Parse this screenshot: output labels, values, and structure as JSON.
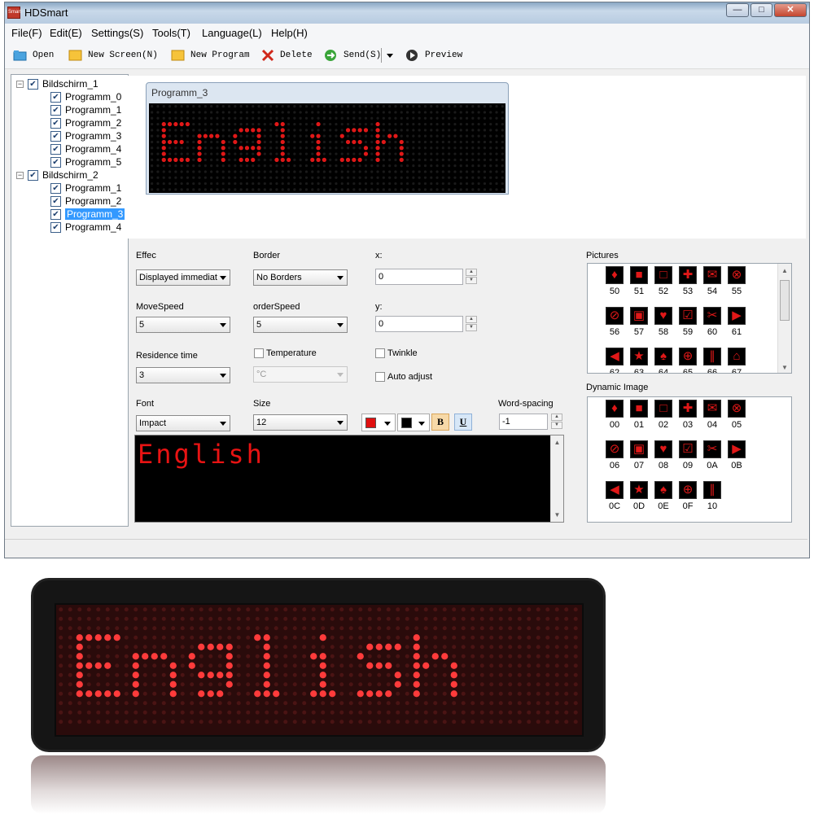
{
  "app": {
    "title": "HDSmart",
    "icon_label": "Smart"
  },
  "window_buttons": {
    "minimize": "—",
    "maximize": "□",
    "close": "✕"
  },
  "menu": [
    {
      "label": "File(F)"
    },
    {
      "label": "Edit(E)"
    },
    {
      "label": "Settings(S)"
    },
    {
      "label": "Tools(T)"
    },
    {
      "label": "Language(L)"
    },
    {
      "label": "Help(H)"
    }
  ],
  "toolbar": {
    "open": "Open",
    "new_screen": "New Screen(N)",
    "new_program": "New Program",
    "delete": "Delete",
    "send": "Send(S)",
    "preview": "Preview"
  },
  "tree": {
    "screens": [
      {
        "label": "Bildschirm_1",
        "programs": [
          "Programm_0",
          "Programm_1",
          "Programm_2",
          "Programm_3",
          "Programm_4",
          "Programm_5"
        ]
      },
      {
        "label": "Bildschirm_2",
        "programs": [
          "Programm_1",
          "Programm_2",
          "Programm_3",
          "Programm_4"
        ]
      }
    ],
    "selected": "Bildschirm_2/Programm_3"
  },
  "preview_window": {
    "caption": "Programm_3",
    "led_text": "English"
  },
  "settings": {
    "effect_label": "Effec",
    "effect_value": "Displayed immediat",
    "border_label": "Border",
    "border_value": "No Borders",
    "x_label": "x:",
    "x_value": "0",
    "move_speed_label": "MoveSpeed",
    "move_speed_value": "5",
    "order_speed_label": "orderSpeed",
    "order_speed_value": "5",
    "y_label": "y:",
    "y_value": "0",
    "residence_label": "Residence time",
    "residence_value": "3",
    "temperature_label": "Temperature",
    "temperature_unit": "°C",
    "twinkle_label": "Twinkle",
    "auto_adjust_label": "Auto adjust",
    "font_label": "Font",
    "font_value": "Impact",
    "size_label": "Size",
    "size_value": "12",
    "bold_label": "B",
    "underline_label": "U",
    "word_spacing_label": "Word-spacing",
    "word_spacing_value": "-1",
    "fg_color": "#e01010",
    "bg_color": "#000000"
  },
  "editor": {
    "text": "English",
    "text_color": "#e81313"
  },
  "pictures": {
    "label": "Pictures",
    "items": [
      "50",
      "51",
      "52",
      "53",
      "54",
      "55",
      "56",
      "57",
      "58",
      "59",
      "60",
      "61",
      "62",
      "63",
      "64",
      "65",
      "66",
      "67"
    ]
  },
  "dynamic_image": {
    "label": "Dynamic Image",
    "items": [
      "00",
      "01",
      "02",
      "03",
      "04",
      "05",
      "06",
      "07",
      "08",
      "09",
      "0A",
      "0B",
      "0C",
      "0D",
      "0E",
      "0F",
      "10"
    ]
  },
  "badge": {
    "text": "English",
    "led_color": "#ff3b3b"
  }
}
